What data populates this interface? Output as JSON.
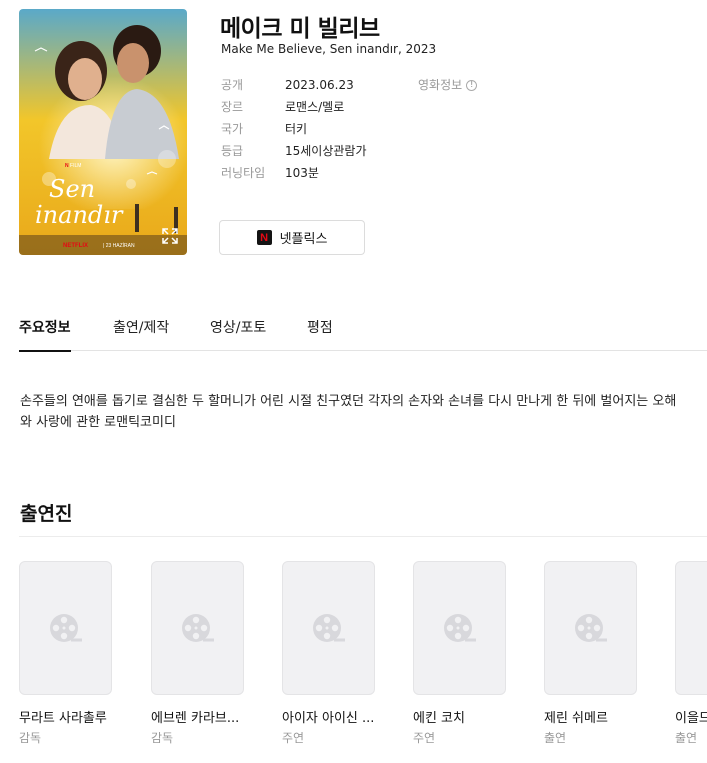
{
  "poster": {
    "script_title": "Sen\ninandır",
    "brand": "NETFLIX",
    "date_text": "23 HAZİRAN",
    "film_tag": "FILM",
    "expand_icon": "expand-icon"
  },
  "movie": {
    "title": "메이크 미 빌리브",
    "subtitle": "Make Me Believe, Sen inandır, 2023"
  },
  "info": [
    {
      "key": "공개",
      "value": "2023.06.23"
    },
    {
      "key": "장르",
      "value": "로맨스/멜로"
    },
    {
      "key": "국가",
      "value": "터키"
    },
    {
      "key": "등급",
      "value": "15세이상관람가"
    },
    {
      "key": "러닝타임",
      "value": "103분"
    }
  ],
  "movie_info_link": {
    "label": "영화정보",
    "icon": "!"
  },
  "streaming": {
    "label": "넷플릭스",
    "logo": "N"
  },
  "tabs": [
    {
      "label": "주요정보",
      "active": true
    },
    {
      "label": "출연/제작",
      "active": false
    },
    {
      "label": "영상/포토",
      "active": false
    },
    {
      "label": "평점",
      "active": false
    }
  ],
  "synopsis": "손주들의 연애를 돕기로 결심한 두 할머니가 어린 시절 친구였던 각자의 손자와 손녀를 다시 만나게 한 뒤에 벌어지는 오해와 사랑에 관한 로맨틱코미디",
  "cast_section": {
    "title": "출연진",
    "people": [
      {
        "name": "무라트 사라촐루",
        "role": "감독"
      },
      {
        "name": "에브렌 카라브...",
        "role": "감독"
      },
      {
        "name": "아이자 아이신 ...",
        "role": "주연"
      },
      {
        "name": "에킨 코치",
        "role": "주연"
      },
      {
        "name": "제린 쉬메르",
        "role": "출연"
      },
      {
        "name": "이을드",
        "role": "출연"
      }
    ]
  },
  "colors": {
    "accent": "#111111",
    "muted": "#999999",
    "netflix_red": "#e50914"
  }
}
